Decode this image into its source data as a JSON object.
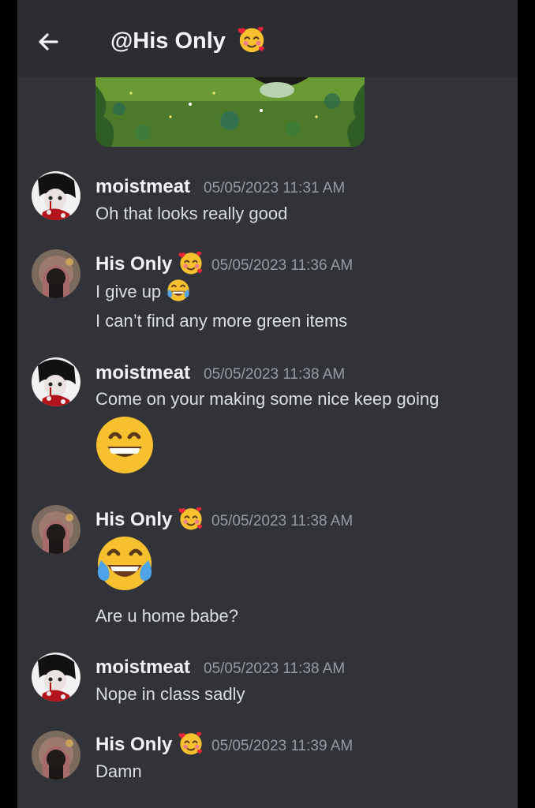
{
  "header": {
    "title": "@His Only",
    "title_emoji": "smiling-face-with-hearts-icon",
    "back_icon": "arrow-left-icon"
  },
  "colors": {
    "background": "#313338",
    "header_bg": "#2b2d31",
    "username": "#f2f3f5",
    "timestamp": "#949ba4",
    "message_text": "#dbdee1"
  },
  "messages": [
    {
      "author": "moistmeat",
      "timestamp": "05/05/2023 11:31 AM",
      "lines": [
        "Oh that  looks really good"
      ]
    },
    {
      "author": "His Only",
      "author_emoji": "smiling-face-with-hearts-icon",
      "timestamp": "05/05/2023 11:36 AM",
      "lines": [
        "I give up",
        "I can’t find any more green items"
      ],
      "inline_emoji": "tears-of-joy-icon"
    },
    {
      "author": "moistmeat",
      "timestamp": "05/05/2023 11:38 AM",
      "lines": [
        "Come on your making some nice keep going"
      ],
      "big_emoji": "grinning-face-icon"
    },
    {
      "author": "His Only",
      "author_emoji": "smiling-face-with-hearts-icon",
      "timestamp": "05/05/2023 11:38 AM",
      "big_emoji": "tears-of-joy-icon",
      "lines": [
        "Are u home babe?"
      ]
    },
    {
      "author": "moistmeat",
      "timestamp": "05/05/2023 11:38 AM",
      "lines": [
        "Nope in class sadly"
      ]
    },
    {
      "author": "His Only",
      "author_emoji": "smiling-face-with-hearts-icon",
      "timestamp": "05/05/2023 11:39 AM",
      "lines": [
        "Damn"
      ]
    }
  ]
}
